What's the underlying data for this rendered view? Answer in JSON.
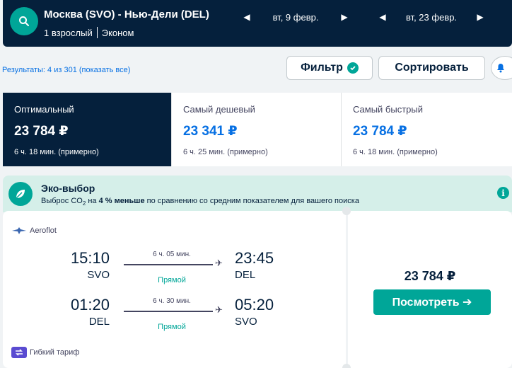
{
  "header": {
    "route": "Москва (SVO) - Нью-Дели (DEL)",
    "passengers": "1 взрослый",
    "cabin": "Эконом",
    "outbound_date": "вт, 9 февр.",
    "return_date": "вт, 23 февр."
  },
  "results": {
    "summary": "Результаты: 4 из 301 (показать все)",
    "filter_label": "Фильтр",
    "sort_label": "Сортировать"
  },
  "tabs": [
    {
      "title": "Оптимальный",
      "price": "23 784 ₽",
      "duration": "6 ч. 18 мин. (примерно)"
    },
    {
      "title": "Самый дешевый",
      "price": "23 341 ₽",
      "duration": "6 ч. 25 мин. (примерно)"
    },
    {
      "title": "Самый быстрый",
      "price": "23 784 ₽",
      "duration": "6 ч. 18 мин. (примерно)"
    }
  ],
  "eco": {
    "title": "Эко-выбор",
    "text_before": "Выброс CO",
    "text_sub": "2",
    "text_mid": " на ",
    "text_bold": "4 % меньше",
    "text_after": " по сравнению со средним показателем для вашего поиска"
  },
  "ticket": {
    "airline": "Aeroflot",
    "legs": [
      {
        "dep_time": "15:10",
        "dep_code": "SVO",
        "duration": "6 ч. 05 мин.",
        "stops": "Прямой",
        "arr_time": "23:45",
        "arr_code": "DEL"
      },
      {
        "dep_time": "01:20",
        "dep_code": "DEL",
        "duration": "6 ч. 30 мин.",
        "stops": "Прямой",
        "arr_time": "05:20",
        "arr_code": "SVO"
      }
    ],
    "flex_fare": "Гибкий тариф",
    "price": "23 784 ₽",
    "view_label": "Посмотреть ➔"
  },
  "colors": {
    "navy": "#05203c",
    "teal": "#00a698",
    "blue": "#0770e3",
    "eco_bg": "#d5efe9"
  }
}
